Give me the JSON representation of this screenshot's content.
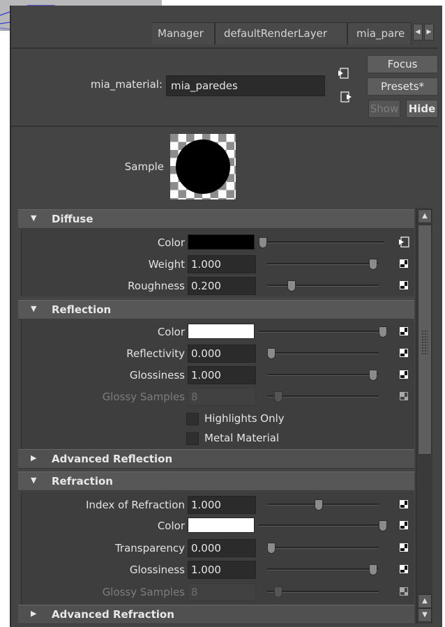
{
  "tabs": [
    {
      "label": "Manager"
    },
    {
      "label": "defaultRenderLayer"
    },
    {
      "label": "mia_pare"
    }
  ],
  "node": {
    "type_label": "mia_material:",
    "name_value": "mia_paredes"
  },
  "buttons": {
    "focus": "Focus",
    "presets": "Presets*",
    "show": "Show",
    "hide": "Hide"
  },
  "sample": {
    "label": "Sample"
  },
  "sections": {
    "diffuse": {
      "title": "Diffuse",
      "expanded": true,
      "color_label": "Color",
      "color_value": "#000000",
      "weight_label": "Weight",
      "weight_value": "1.000",
      "weight_slider": 1.0,
      "roughness_label": "Roughness",
      "roughness_value": "0.200",
      "roughness_slider": 0.2
    },
    "reflection": {
      "title": "Reflection",
      "expanded": true,
      "color_label": "Color",
      "color_value": "#ffffff",
      "reflectivity_label": "Reflectivity",
      "reflectivity_value": "0.000",
      "reflectivity_slider": 0.0,
      "glossiness_label": "Glossiness",
      "glossiness_value": "1.000",
      "glossiness_slider": 1.0,
      "glossy_samples_label": "Glossy Samples",
      "glossy_samples_value": "8",
      "highlights_only_label": "Highlights Only",
      "metal_material_label": "Metal Material"
    },
    "advanced_reflection": {
      "title": "Advanced Reflection",
      "expanded": false
    },
    "refraction": {
      "title": "Refraction",
      "expanded": true,
      "ior_label": "Index of Refraction",
      "ior_value": "1.000",
      "ior_slider": 0.5,
      "color_label": "Color",
      "color_value": "#ffffff",
      "transparency_label": "Transparency",
      "transparency_value": "0.000",
      "transparency_slider": 0.0,
      "glossiness_label": "Glossiness",
      "glossiness_value": "1.000",
      "glossiness_slider": 1.0,
      "glossy_samples_label": "Glossy Samples",
      "glossy_samples_value": "8"
    },
    "advanced_refraction": {
      "title": "Advanced Refraction",
      "expanded": false
    }
  },
  "icons": {
    "expanded": "triangle-down-icon",
    "collapsed": "triangle-right-icon",
    "map": "checker-map-icon",
    "connection": "input-connection-icon"
  },
  "colors": {
    "panel_bg": "#444444",
    "header_bg": "#575757",
    "field_bg": "#2b2b2b",
    "text": "#e3e3e3"
  }
}
